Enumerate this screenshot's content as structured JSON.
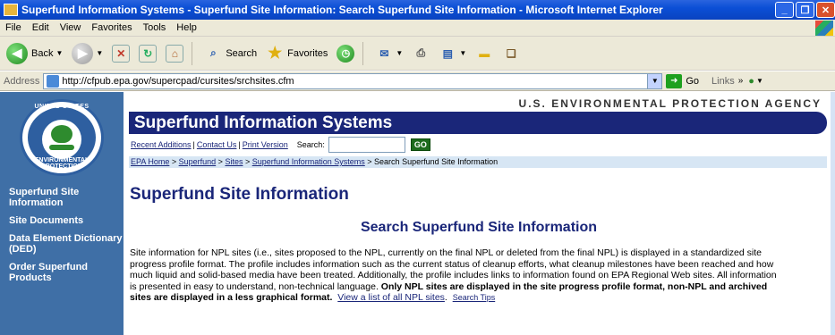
{
  "window": {
    "title": "Superfund Information Systems - Superfund Site Information: Search Superfund Site Information - Microsoft Internet Explorer",
    "minimize_glyph": "_",
    "maximize_glyph": "❐",
    "close_glyph": "✕"
  },
  "menu": {
    "items": [
      "File",
      "Edit",
      "View",
      "Favorites",
      "Tools",
      "Help"
    ]
  },
  "toolbar": {
    "back_label": "Back",
    "search_label": "Search",
    "favorites_label": "Favorites"
  },
  "address": {
    "label": "Address",
    "url": "http://cfpub.epa.gov/supercpad/cursites/srchsites.cfm",
    "go_label": "Go",
    "links_label": "Links"
  },
  "logo": {
    "top_text": "UNITED STATES",
    "bottom_text": "ENVIRONMENTAL PROTECTION",
    "alt": "EPA seal"
  },
  "sidebar": {
    "items": [
      {
        "label": "Superfund Site Information"
      },
      {
        "label": "Site Documents"
      },
      {
        "label": "Data Element Dictionary (DED)"
      },
      {
        "label": "Order Superfund Products"
      }
    ]
  },
  "header": {
    "agency": "U.S. ENVIRONMENTAL PROTECTION AGENCY",
    "title": "Superfund Information Systems",
    "recent": "Recent Additions",
    "contact": "Contact Us",
    "print": "Print Version",
    "search_label": "Search:",
    "search_value": "",
    "go": "GO"
  },
  "breadcrumb": {
    "items": [
      "EPA Home",
      "Superfund",
      "Sites",
      "Superfund Information Systems"
    ],
    "current": "Search Superfund Site Information",
    "sep": " > "
  },
  "main": {
    "heading": "Superfund Site Information",
    "subheading": "Search Superfund Site Information",
    "paragraph": "Site information for NPL sites (i.e., sites proposed to the NPL, currently on the final NPL or deleted from the final NPL) is displayed in a standardized site progress profile format. The profile includes information such as the current status of cleanup efforts, what cleanup milestones have been reached and how much liquid and solid-based media have been treated. Additionally, the profile includes links to information found on EPA Regional Web sites. All information is presented in easy to understand, non-technical language.",
    "bold_text": "Only NPL sites are displayed in the site progress profile format, non-NPL and archived sites are displayed in a less graphical format.",
    "npl_link": "View a list of all NPL sites",
    "tips_link": "Search Tips"
  },
  "colors": {
    "nav_bg": "#3f6fa6",
    "title_bar": "#1a2679",
    "crumb_bg": "#d7e6f4"
  }
}
